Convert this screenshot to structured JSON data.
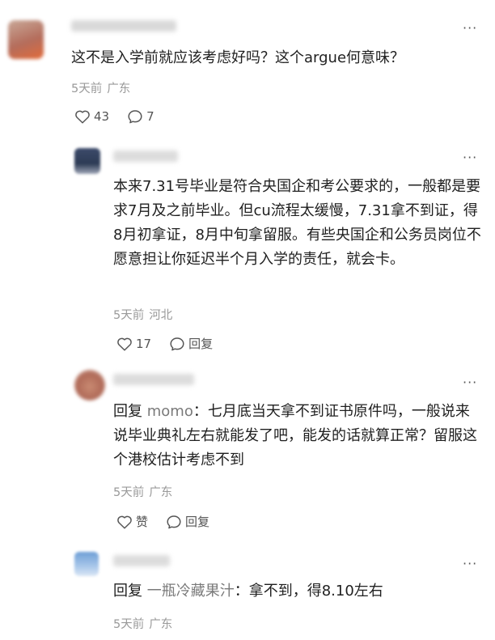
{
  "comments": [
    {
      "text": "这不是入学前就应该考虑好吗？这个argue何意味？",
      "meta": {
        "time": "5天前",
        "location": "广东"
      },
      "likes": "43",
      "replies": "7"
    },
    {
      "text": "本来7.31号毕业是符合央国企和考公要求的，一般都是要求7月及之前毕业。但cu流程太缓慢，7.31拿不到证，得8月初拿证，8月中旬拿留服。有些央国企和公务员岗位不愿意担让你延迟半个月入学的责任，就会卡。",
      "meta": {
        "time": "5天前",
        "location": "河北"
      },
      "likes": "17",
      "reply_label": "回复"
    },
    {
      "reply_prefix": "回复",
      "reply_target": "momo",
      "text": "：七月底当天拿不到证书原件吗，一般说来说毕业典礼左右就能发了吧，能发的话就算正常？留服这个港校估计考虑不到",
      "meta": {
        "time": "5天前",
        "location": "广东"
      },
      "likes": "赞",
      "reply_label": "回复"
    },
    {
      "reply_prefix": "回复",
      "reply_target": "一瓶冷藏果汁",
      "text": "：拿不到，得8.10左右",
      "meta": {
        "time": "5天前",
        "location": "广东"
      }
    }
  ],
  "more_icon": "···"
}
